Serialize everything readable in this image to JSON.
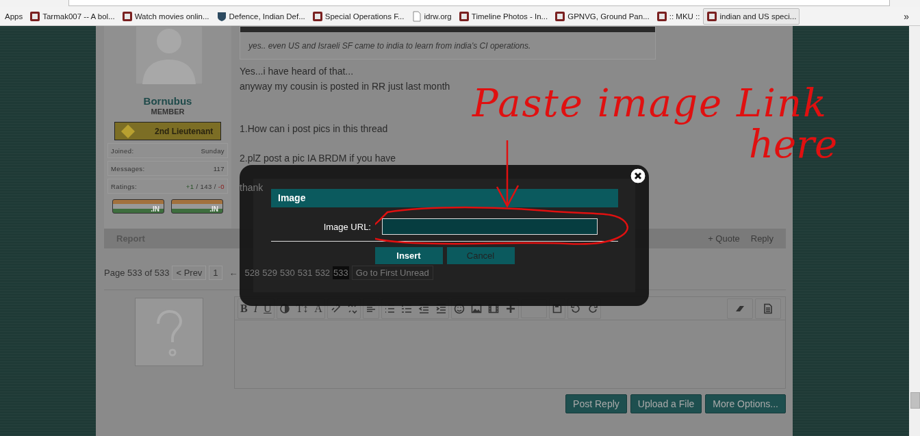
{
  "bookmarks": [
    {
      "label": "Apps",
      "kind": "apps",
      "selected": false
    },
    {
      "label": "Tarmak007 -- A bol...",
      "kind": "site",
      "selected": false
    },
    {
      "label": "Watch movies onlin...",
      "kind": "site",
      "selected": false
    },
    {
      "label": "Defence, Indian Def...",
      "kind": "shield",
      "selected": false
    },
    {
      "label": "Special Operations F...",
      "kind": "site",
      "selected": false
    },
    {
      "label": "idrw.org",
      "kind": "page",
      "selected": false
    },
    {
      "label": "Timeline Photos - In...",
      "kind": "site",
      "selected": false
    },
    {
      "label": "GPNVG, Ground Pan...",
      "kind": "site",
      "selected": false
    },
    {
      "label": ":: MKU ::",
      "kind": "site",
      "selected": false
    },
    {
      "label": "indian and US speci...",
      "kind": "site",
      "selected": true
    }
  ],
  "bookmarks_overflow": "»",
  "user": {
    "name": "Bornubus",
    "role": "MEMBER",
    "rank": "2nd Lieutenant",
    "stats": [
      {
        "label": "Joined:",
        "value": [
          {
            "text": "Sunday",
            "kind": "plain"
          }
        ]
      },
      {
        "label": "Messages:",
        "value": [
          {
            "text": "117",
            "kind": "plain"
          }
        ]
      },
      {
        "label": "Ratings:",
        "value": [
          {
            "text": "+1",
            "kind": "positive"
          },
          {
            "text": " / 143 / ",
            "kind": "plain"
          },
          {
            "text": "-0",
            "kind": "negative"
          }
        ]
      }
    ],
    "flags": [
      ".IN",
      ".IN"
    ]
  },
  "post": {
    "quote": "yes.. even US and Israeli SF came to india to learn from india's CI operations.",
    "paragraphs": [
      {
        "lines": [
          "Yes...i have heard of that...",
          "anyway my cousin is posted in RR just last month"
        ]
      },
      {
        "lines": [
          "1.How can i post pics in this thread"
        ]
      },
      {
        "lines": [
          "2.plZ post a pic IA BRDM if you have"
        ]
      },
      {
        "lines": [
          "thank"
        ]
      }
    ],
    "actions_left": [
      "Report"
    ],
    "actions_right": [
      "+ Quote",
      "Reply"
    ]
  },
  "pagination": {
    "summary": "Page 533 of 533",
    "prev": "< Prev",
    "pages_start": [
      "1"
    ],
    "ellipsis": "←",
    "pages": [
      {
        "label": "528",
        "selected": false
      },
      {
        "label": "529",
        "selected": false
      },
      {
        "label": "530",
        "selected": false
      },
      {
        "label": "531",
        "selected": false
      },
      {
        "label": "532",
        "selected": false
      },
      {
        "label": "533",
        "selected": true
      }
    ],
    "first_unread": "Go to First Unread"
  },
  "editor": {
    "format_buttons": [
      "B",
      "I",
      "U"
    ],
    "font_buttons": [
      "T↕",
      "A"
    ],
    "buttons": [
      "Post Reply",
      "Upload a File",
      "More Options..."
    ]
  },
  "dialog": {
    "title": "Image",
    "field_label": "Image URL:",
    "field_focused": true,
    "buttons": [
      {
        "label": "Insert",
        "kind": "primary"
      },
      {
        "label": "Cancel",
        "kind": "secondary"
      }
    ]
  },
  "annotation": {
    "lines": [
      "Paste image Link",
      "here"
    ]
  }
}
